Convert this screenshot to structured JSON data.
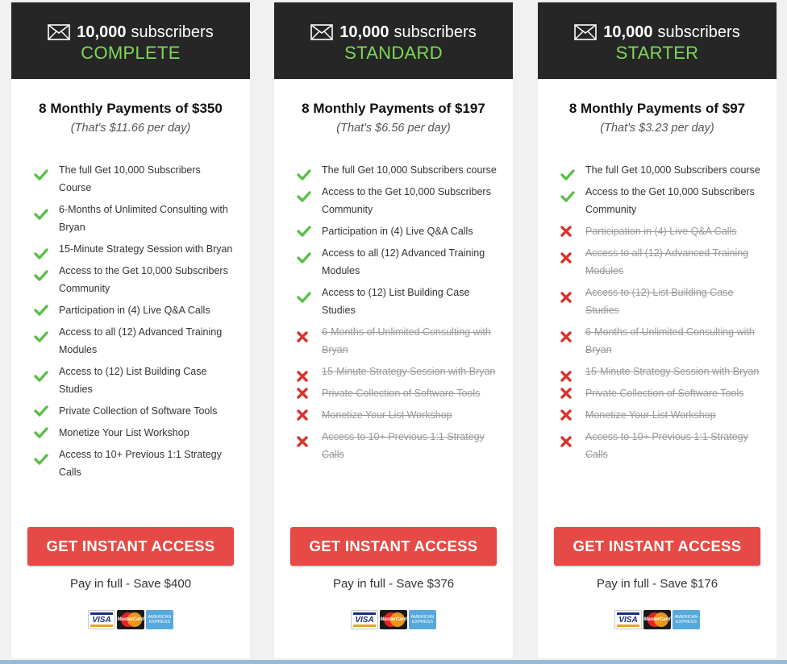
{
  "plans": [
    {
      "subscribers_num": "10,000",
      "subscribers_word": "subscribers",
      "tier": "COMPLETE",
      "price": "8 Monthly Payments of $350",
      "per_day": "(That's $11.66 per day)",
      "features": [
        {
          "text": "The full Get 10,000 Subscribers Course",
          "included": true
        },
        {
          "text": "6-Months of Unlimited Consulting with Bryan",
          "included": true
        },
        {
          "text": "15-Minute Strategy Session with Bryan",
          "included": true
        },
        {
          "text": "Access to the Get 10,000 Subscribers Community",
          "included": true
        },
        {
          "text": "Participation in (4) Live Q&A Calls",
          "included": true
        },
        {
          "text": "Access to all (12) Advanced Training Modules",
          "included": true
        },
        {
          "text": "Access to (12) List Building Case Studies",
          "included": true
        },
        {
          "text": "Private Collection of Software Tools",
          "included": true
        },
        {
          "text": "Monetize Your List Workshop",
          "included": true
        },
        {
          "text": "Access to 10+ Previous 1:1 Strategy Calls",
          "included": true
        }
      ],
      "cta": "GET INSTANT ACCESS",
      "pay_full": "Pay in full - Save $400"
    },
    {
      "subscribers_num": "10,000",
      "subscribers_word": "subscribers",
      "tier": "STANDARD",
      "price": "8 Monthly Payments of $197",
      "per_day": "(That's $6.56 per day)",
      "features": [
        {
          "text": "The full Get 10,000 Subscribers course",
          "included": true
        },
        {
          "text": "Access to the Get 10,000 Subscribers Community",
          "included": true
        },
        {
          "text": "Participation in (4) Live Q&A Calls",
          "included": true
        },
        {
          "text": "Access to all (12) Advanced Training Modules",
          "included": true
        },
        {
          "text": "Access to (12) List Building Case Studies",
          "included": true
        },
        {
          "text": "6-Months of Unlimited Consulting with Bryan",
          "included": false
        },
        {
          "text": "15-Minute Strategy Session with Bryan",
          "included": false
        },
        {
          "text": "Private Collection of Software Tools",
          "included": false
        },
        {
          "text": "Monetize Your List Workshop",
          "included": false
        },
        {
          "text": "Access to 10+ Previous 1:1 Strategy Calls",
          "included": false
        }
      ],
      "cta": "GET INSTANT ACCESS",
      "pay_full": "Pay in full - Save $376"
    },
    {
      "subscribers_num": "10,000",
      "subscribers_word": "subscribers",
      "tier": "STARTER",
      "price": "8 Monthly Payments of $97",
      "per_day": "(That's $3.23 per day)",
      "features": [
        {
          "text": "The full Get 10,000 Subscribers course",
          "included": true
        },
        {
          "text": "Access to the Get 10,000 Subscribers Community",
          "included": true
        },
        {
          "text": "Participation in (4) Live Q&A Calls",
          "included": false
        },
        {
          "text": "Access to all (12) Advanced Training Modules",
          "included": false
        },
        {
          "text": "Access to (12) List Building Case Studies",
          "included": false
        },
        {
          "text": "6-Months of Unlimited Consulting with Bryan",
          "included": false
        },
        {
          "text": "15-Minute Strategy Session with Bryan",
          "included": false
        },
        {
          "text": "Private Collection of Software Tools",
          "included": false
        },
        {
          "text": "Monetize Your List Workshop",
          "included": false
        },
        {
          "text": "Access to 10+ Previous 1:1 Strategy Calls",
          "included": false
        }
      ],
      "cta": "GET INSTANT ACCESS",
      "pay_full": "Pay in full - Save $176"
    }
  ],
  "payment_cards": [
    {
      "name": "visa-card-icon",
      "label": "VISA"
    },
    {
      "name": "mastercard-icon",
      "label": "MasterCard"
    },
    {
      "name": "amex-card-icon",
      "label": "AMERICAN EXPRESS"
    }
  ],
  "colors": {
    "header_bg": "#262626",
    "tier_green": "#7ed957",
    "cta_red": "#e64a46",
    "check_green": "#5cbf4a",
    "cross_red": "#d9342b"
  }
}
